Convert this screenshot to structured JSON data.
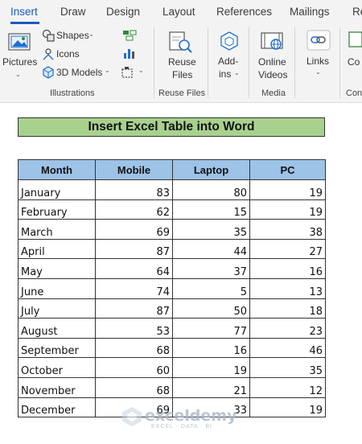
{
  "ribbon": {
    "tabs": [
      "Insert",
      "Draw",
      "Design",
      "Layout",
      "References",
      "Mailings",
      "Re"
    ],
    "active_tab": "Insert",
    "illustrations": {
      "pictures": "Pictures",
      "shapes": "Shapes",
      "icons": "Icons",
      "models": "3D Models",
      "group_label": "Illustrations"
    },
    "reuse_files": {
      "button_line1": "Reuse",
      "button_line2": "Files",
      "group_label": "Reuse Files"
    },
    "addins": {
      "line1": "Add-",
      "line2": "ins"
    },
    "media": {
      "line1": "Online",
      "line2": "Videos",
      "group_label": "Media"
    },
    "links": {
      "label": "Links"
    },
    "cut_off": {
      "label": "Co",
      "group_label": "Con"
    }
  },
  "document": {
    "title": "Insert Excel Table into Word",
    "table": {
      "headers": [
        "Month",
        "Mobile",
        "Laptop",
        "PC"
      ],
      "rows": [
        [
          "January",
          "83",
          "80",
          "19"
        ],
        [
          "February",
          "62",
          "15",
          "19"
        ],
        [
          "March",
          "69",
          "35",
          "38"
        ],
        [
          "April",
          "87",
          "44",
          "27"
        ],
        [
          "May",
          "64",
          "37",
          "16"
        ],
        [
          "June",
          "74",
          "5",
          "13"
        ],
        [
          "July",
          "87",
          "50",
          "18"
        ],
        [
          "August",
          "53",
          "77",
          "23"
        ],
        [
          "September",
          "68",
          "16",
          "46"
        ],
        [
          "October",
          "60",
          "19",
          "35"
        ],
        [
          "November",
          "68",
          "21",
          "12"
        ],
        [
          "December",
          "69",
          "33",
          "19"
        ]
      ]
    }
  },
  "watermark": {
    "name": "exceldemy",
    "tagline": "EXCEL · DATA · BI"
  },
  "colors": {
    "accent": "#185abd",
    "title_fill": "#a9d18e",
    "header_fill": "#9dc3e6"
  }
}
